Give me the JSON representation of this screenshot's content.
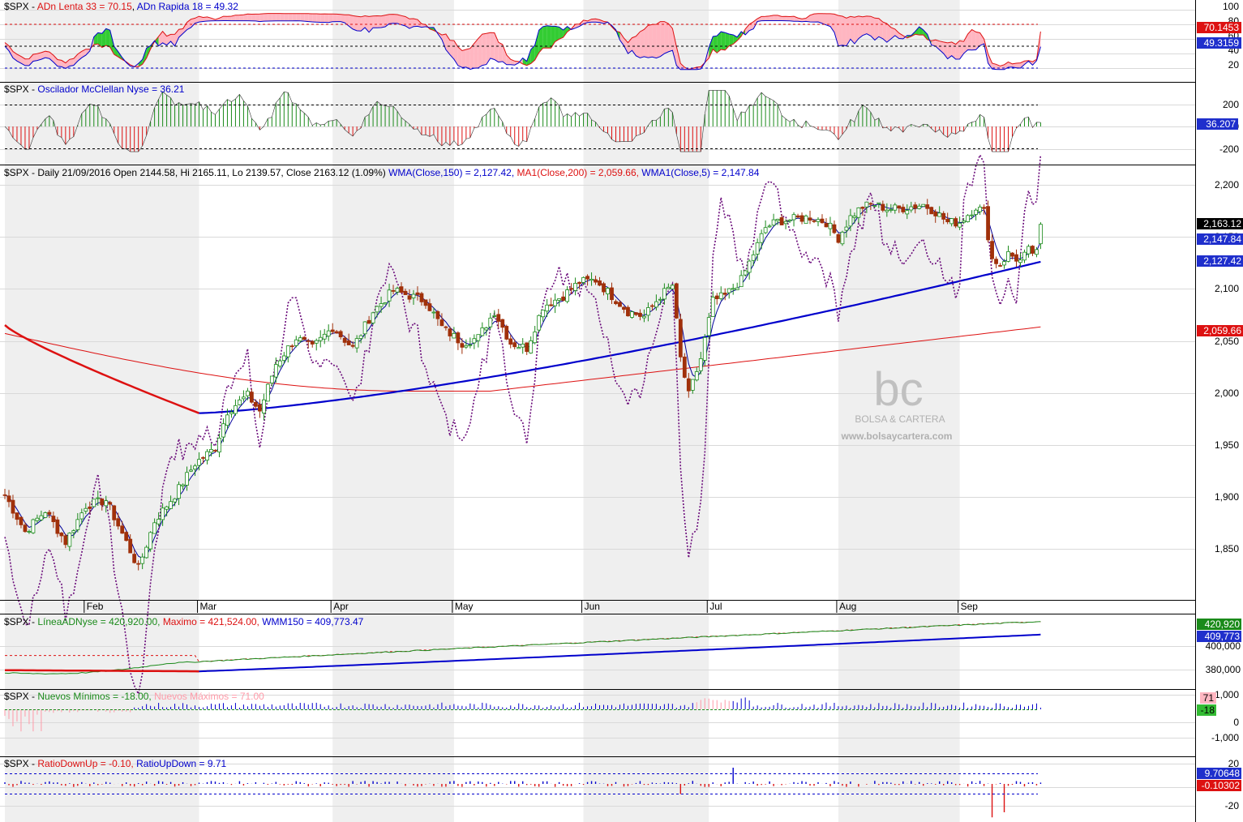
{
  "colors": {
    "grid": "#d9d9d9",
    "axis": "#000000",
    "up_candle_fill": "#ffffff",
    "up_candle_stroke": "#1a8a1a",
    "down_candle": "#a0300a",
    "wma150": "#0000cc",
    "ma200": "#dd1111",
    "wma5": "#000099",
    "green_line": "#1a8a1a",
    "red_line": "#dd1111",
    "blue_line": "#0000cc",
    "purple_dotted": "#6a0a7a",
    "pink_fill": "#ffb6c1",
    "green_fill": "#33cc33",
    "pink_bar": "#ff9aa8",
    "watermark": "#b0b0b0"
  },
  "months": [
    "Feb",
    "Mar",
    "Apr",
    "May",
    "Jun",
    "Jul",
    "Aug",
    "Sep"
  ],
  "watermark": {
    "brand": "BOLSA & CARTERA",
    "url": "www.bolsaycartera.com"
  },
  "panels": {
    "adn": {
      "title_prefix": "$SPX - ",
      "label1": "ADn Lenta 33 = 70.15",
      "label2": "ADn Rapida 18 = 49.32",
      "ticks": [
        "100",
        "80",
        "60",
        "40",
        "20"
      ],
      "tags": [
        "70.1453",
        "49.3159"
      ]
    },
    "mcclellan": {
      "title_prefix": "$SPX - ",
      "label1": "Oscilador McClellan Nyse = 36.21",
      "ticks": [
        "200",
        "0",
        "-200"
      ],
      "tags": [
        "36.207"
      ]
    },
    "price": {
      "title_prefix": "$SPX - Daily 21/09/2016 Open 2144.58, Hi 2165.11, Lo 2139.57, Close 2163.12 (1.09%) ",
      "label_wma150": "WMA(Close,150) = 2,127.42,",
      "label_ma200": "MA1(Close,200) = 2,059.66,",
      "label_wma5": "WMA1(Close,5) = 2,147.84",
      "ticks": [
        "2,200",
        "2,150",
        "2,100",
        "2,050",
        "2,000",
        "1,950",
        "1,900",
        "1,850"
      ],
      "tags": [
        "2,163.12",
        "2,147.84",
        "2,127.42",
        "2,059.66"
      ]
    },
    "adline": {
      "title_prefix": "$SPX - ",
      "label1": "LíneaADNyse = 420,920.00,",
      "label2": "Maximo = 421,524.00,",
      "label3": "WMM150 = 409,773.47",
      "ticks": [
        "400,000",
        "380,000"
      ],
      "tags": [
        "420,920",
        "409,773"
      ]
    },
    "lows": {
      "title_prefix": "$SPX - ",
      "label1": "Nuevos Mínimos = -18.00,",
      "label2": "Nuevos Máximos = 71.00",
      "ticks": [
        "1,000",
        "0",
        "-1,000"
      ],
      "tags": [
        "71",
        "-18"
      ]
    },
    "ratio": {
      "title_prefix": "$SPX - ",
      "label1": "RatioDownUp = -0.10,",
      "label2": "RatioUpDown = 9.71",
      "ticks": [
        "20",
        "0",
        "-20"
      ],
      "tags": [
        "9.70648",
        "-0.10302"
      ]
    }
  },
  "chart_data": {
    "type": "candlestick",
    "title": "$SPX - Daily 21/09/2016",
    "ylim": [
      1812,
      2220
    ],
    "last_bar": {
      "date": "21/09/2016",
      "open": 2144.58,
      "high": 2165.11,
      "low": 2139.57,
      "close": 2163.12,
      "change_pct": 1.09
    },
    "series": [
      {
        "name": "WMA(Close,150)",
        "last": 2127.42
      },
      {
        "name": "MA1(Close,200)",
        "last": 2059.66
      },
      {
        "name": "WMA1(Close,5)",
        "last": 2147.84
      }
    ],
    "anchors": [
      [
        0,
        1905
      ],
      [
        5,
        1870
      ],
      [
        10,
        1890
      ],
      [
        15,
        1860
      ],
      [
        20,
        1895
      ],
      [
        25,
        1900
      ],
      [
        30,
        1860
      ],
      [
        33,
        1835
      ],
      [
        37,
        1880
      ],
      [
        42,
        1905
      ],
      [
        47,
        1935
      ],
      [
        52,
        1950
      ],
      [
        55,
        1985
      ],
      [
        60,
        2000
      ],
      [
        63,
        1985
      ],
      [
        67,
        2030
      ],
      [
        72,
        2055
      ],
      [
        76,
        2045
      ],
      [
        81,
        2065
      ],
      [
        86,
        2045
      ],
      [
        91,
        2080
      ],
      [
        96,
        2100
      ],
      [
        100,
        2095
      ],
      [
        104,
        2090
      ],
      [
        108,
        2065
      ],
      [
        113,
        2050
      ],
      [
        117,
        2055
      ],
      [
        121,
        2080
      ],
      [
        125,
        2050
      ],
      [
        129,
        2045
      ],
      [
        133,
        2085
      ],
      [
        138,
        2095
      ],
      [
        142,
        2108
      ],
      [
        146,
        2110
      ],
      [
        150,
        2095
      ],
      [
        154,
        2080
      ],
      [
        158,
        2075
      ],
      [
        162,
        2095
      ],
      [
        165,
        2105
      ],
      [
        167,
        2035
      ],
      [
        169,
        2000
      ],
      [
        172,
        2035
      ],
      [
        175,
        2090
      ],
      [
        178,
        2095
      ],
      [
        182,
        2110
      ],
      [
        185,
        2135
      ],
      [
        188,
        2160
      ],
      [
        191,
        2166
      ],
      [
        195,
        2168
      ],
      [
        199,
        2170
      ],
      [
        203,
        2165
      ],
      [
        206,
        2150
      ],
      [
        209,
        2170
      ],
      [
        212,
        2180
      ],
      [
        215,
        2182
      ],
      [
        218,
        2178
      ],
      [
        221,
        2178
      ],
      [
        224,
        2180
      ],
      [
        227,
        2182
      ],
      [
        230,
        2175
      ],
      [
        233,
        2165
      ],
      [
        236,
        2165
      ],
      [
        240,
        2180
      ],
      [
        242,
        2175
      ],
      [
        244,
        2130
      ],
      [
        246,
        2125
      ],
      [
        248,
        2135
      ],
      [
        251,
        2128
      ],
      [
        253,
        2138
      ],
      [
        255,
        2135
      ],
      [
        256,
        2163
      ]
    ]
  }
}
